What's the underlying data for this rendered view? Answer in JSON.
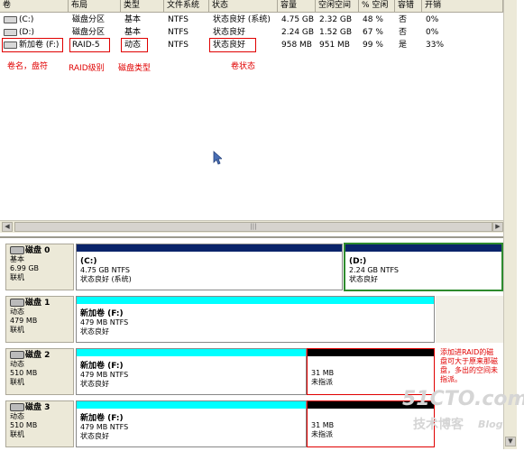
{
  "columns": [
    "卷",
    "布局",
    "类型",
    "文件系统",
    "状态",
    "容量",
    "空闲空间",
    "% 空闲",
    "容错",
    "开销"
  ],
  "volumes": [
    {
      "name": "(C:)",
      "layout": "磁盘分区",
      "type": "基本",
      "fs": "NTFS",
      "status": "状态良好 (系统)",
      "capacity": "4.75 GB",
      "free": "2.32 GB",
      "pct": "48 %",
      "fault": "否",
      "overhead": "0%"
    },
    {
      "name": "(D:)",
      "layout": "磁盘分区",
      "type": "基本",
      "fs": "NTFS",
      "status": "状态良好",
      "capacity": "2.24 GB",
      "free": "1.52 GB",
      "pct": "67 %",
      "fault": "否",
      "overhead": "0%"
    },
    {
      "name": "新加卷 (F:)",
      "layout": "RAID-5",
      "type": "动态",
      "fs": "NTFS",
      "status": "状态良好",
      "capacity": "958 MB",
      "free": "951 MB",
      "pct": "99 %",
      "fault": "是",
      "overhead": "33%"
    }
  ],
  "annotations": {
    "volname": "卷名，盘符",
    "raid": "RAID级别",
    "disktype": "磁盘类型",
    "volstatus": "卷状态",
    "unallocated": "添加进RAID的磁盘可大于原来那磁盘，多出的空间未指派。"
  },
  "scroll_mark": "|||",
  "disks": [
    {
      "name": "磁盘 0",
      "type": "基本",
      "size": "6.99 GB",
      "state": "联机",
      "partitions": [
        {
          "title": "(C:)",
          "line1": "4.75 GB NTFS",
          "line2": "状态良好 (系统)"
        },
        {
          "title": "(D:)",
          "line1": "2.24 GB NTFS",
          "line2": "状态良好"
        }
      ]
    },
    {
      "name": "磁盘 1",
      "type": "动态",
      "size": "479 MB",
      "state": "联机",
      "partitions": [
        {
          "title": "新加卷 (F:)",
          "line1": "479 MB NTFS",
          "line2": "状态良好"
        }
      ]
    },
    {
      "name": "磁盘 2",
      "type": "动态",
      "size": "510 MB",
      "state": "联机",
      "partitions": [
        {
          "title": "新加卷 (F:)",
          "line1": "479 MB NTFS",
          "line2": "状态良好"
        },
        {
          "title": "",
          "line1": "31 MB",
          "line2": "未指派"
        }
      ]
    },
    {
      "name": "磁盘 3",
      "type": "动态",
      "size": "510 MB",
      "state": "联机",
      "partitions": [
        {
          "title": "新加卷 (F:)",
          "line1": "479 MB NTFS",
          "line2": "状态良好"
        },
        {
          "title": "",
          "line1": "31 MB",
          "line2": "未指派"
        }
      ]
    }
  ],
  "watermark": {
    "main": "51CTO.com",
    "sub": "技术博客",
    "blog": "Blog"
  },
  "colors": {
    "basic_bar": "#0a246a",
    "basic_selected_border": "#2e8b2e",
    "raid5_bar": "#00ffff",
    "unallocated_bar": "#000000",
    "annotation": "#e00000"
  }
}
